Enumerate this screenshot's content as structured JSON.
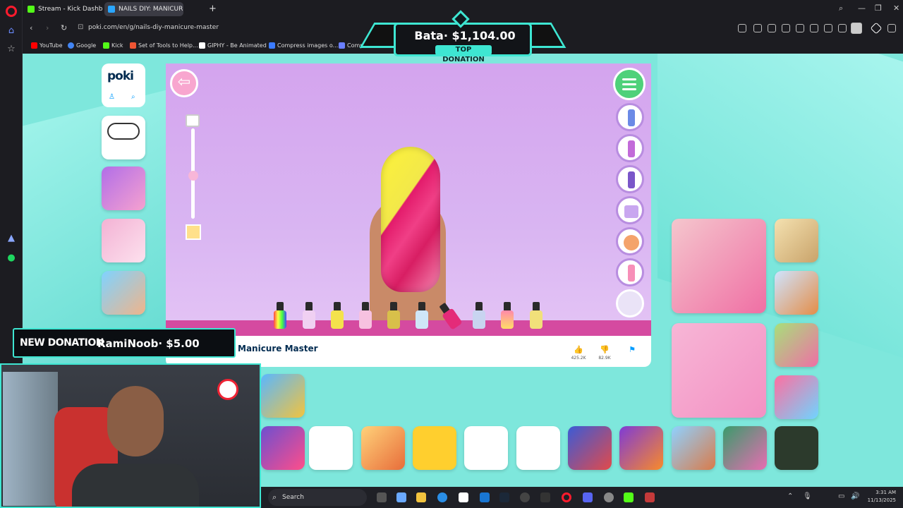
{
  "browser": {
    "tabs": [
      {
        "label": "Stream - Kick Dashboard",
        "color": "#53fc18"
      },
      {
        "label": "NAILS DIY: MANICUR",
        "color": "#2aa6ff"
      }
    ],
    "url": "poki.com/en/g/nails-diy-manicure-master",
    "bookmarks": [
      "YouTube",
      "Google",
      "Kick",
      "Set of Tools to Help...",
      "GIPHY - Be Animated",
      "Compress images o...",
      "Compress"
    ]
  },
  "poki": {
    "logo": "poki",
    "game_title": "Manicure Master",
    "likes": "425.2K",
    "dislikes": "82.9K"
  },
  "overlay": {
    "top_donation_amount": "Bata· $1,104.00",
    "top_donation_label": "TOP DONATION",
    "new_donation_label": "NEW DONATION",
    "new_donation_who": "RamiNoob· $5.00"
  },
  "taskbar": {
    "search_placeholder": "Search",
    "time": "3:31 AM",
    "date": "11/13/2025"
  },
  "colors": {
    "accent": "#3ee6d2",
    "poki_blue": "#009cff",
    "game_bg": "#d9b5f2"
  }
}
